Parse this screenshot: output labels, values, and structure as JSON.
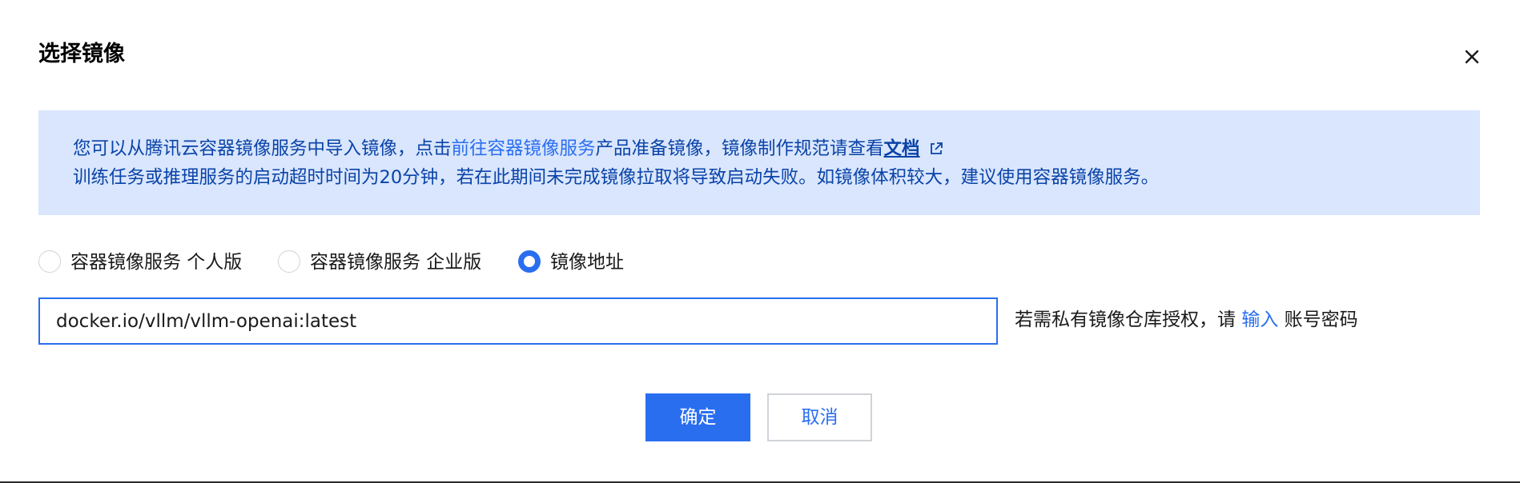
{
  "dialog": {
    "title": "选择镜像",
    "close_icon": "close-icon"
  },
  "notice": {
    "line1_prefix": "您可以从腾讯云容器镜像服务中导入镜像，点击",
    "line1_link": "前往容器镜像服务",
    "line1_middle": "产品准备镜像，镜像制作规范请查看",
    "line1_doc": "文档",
    "line1_doc_icon": "external-link-icon",
    "line2": "训练任务或推理服务的启动超时时间为20分钟，若在此期间未完成镜像拉取将导致启动失败。如镜像体积较大，建议使用容器镜像服务。"
  },
  "source_options": [
    {
      "label": "容器镜像服务 个人版",
      "checked": false
    },
    {
      "label": "容器镜像服务 企业版",
      "checked": false
    },
    {
      "label": "镜像地址",
      "checked": true
    }
  ],
  "image_address": {
    "value": "docker.io/vllm/vllm-openai:latest",
    "placeholder": ""
  },
  "auth_hint": {
    "prefix": "若需私有镜像仓库授权，请 ",
    "link": "输入",
    "suffix": " 账号密码"
  },
  "buttons": {
    "confirm": "确定",
    "cancel": "取消"
  },
  "colors": {
    "accent": "#2a6ef0",
    "notice_bg": "#d9e6fd",
    "notice_text": "#0a43a8"
  }
}
